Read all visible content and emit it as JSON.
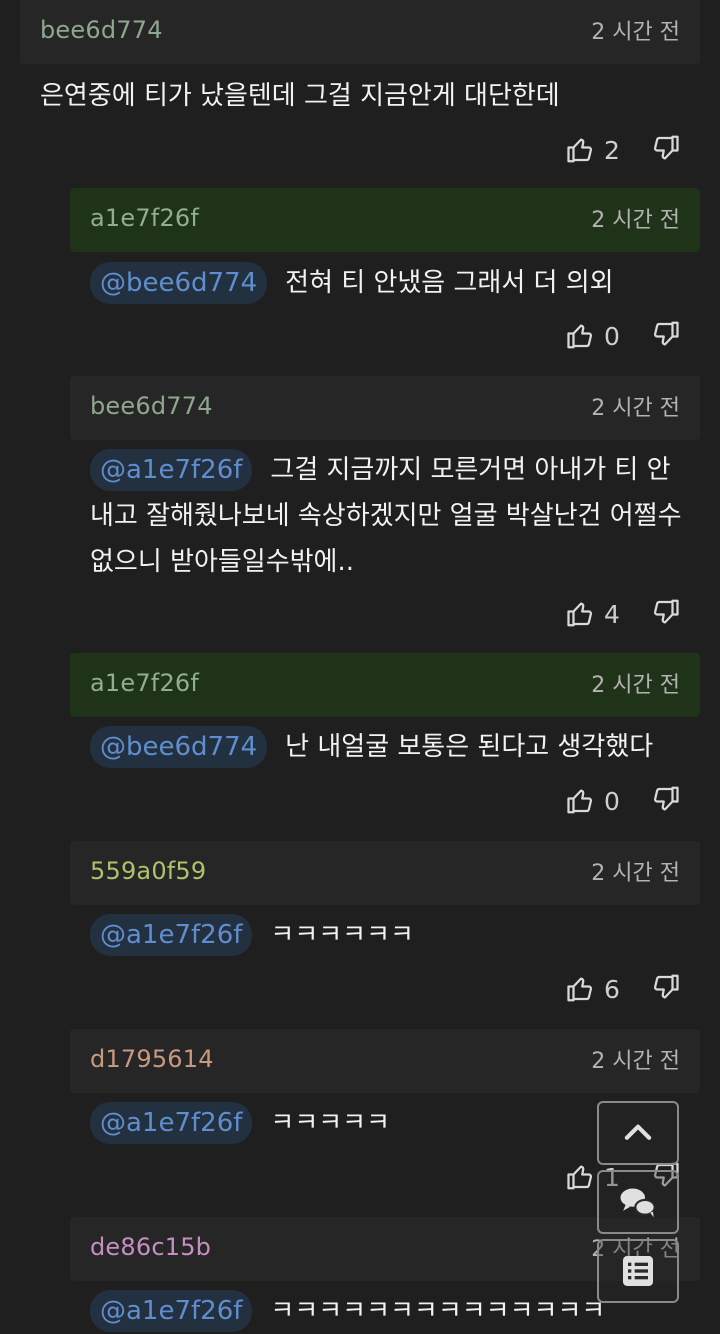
{
  "comments": [
    {
      "user": "bee6d774",
      "user_color": "#8fa68f",
      "time": "2 시간 전",
      "mention": "",
      "text": "은연중에 티가 났을텐데 그걸 지금안게 대단한데",
      "up": "2"
    },
    {
      "user": "a1e7f26f",
      "user_color": "#8fb08a",
      "time": "2 시간 전",
      "mention": "@bee6d774",
      "text": "전혀 티 안냈음 그래서 더 의외",
      "up": "0"
    },
    {
      "user": "bee6d774",
      "user_color": "#8fa68f",
      "time": "2 시간 전",
      "mention": "@a1e7f26f",
      "text_line1": "그걸 지금까지 모른거면 아내가 티 안",
      "text_line2": "내고 잘해줬나보네 속상하겠지만 얼굴 박살난건 어쩔수",
      "text_line3": "없으니 받아들일수밖에..",
      "up": "4"
    },
    {
      "user": "a1e7f26f",
      "user_color": "#8fb08a",
      "time": "2 시간 전",
      "mention": "@bee6d774",
      "text": "난 내얼굴 보통은 된다고 생각했다",
      "up": "0"
    },
    {
      "user": "559a0f59",
      "user_color": "#a9c46c",
      "time": "2 시간 전",
      "mention": "@a1e7f26f",
      "text": "ㅋㅋㅋㅋㅋㅋ",
      "up": "6"
    },
    {
      "user": "d1795614",
      "user_color": "#c79a7e",
      "time": "2 시간 전",
      "mention": "@a1e7f26f",
      "text": "ㅋㅋㅋㅋㅋ",
      "up": "1"
    },
    {
      "user": "de86c15b",
      "user_color": "#c58fc2",
      "time": "2 시간 전",
      "mention": "@a1e7f26f",
      "text": "ㅋㅋㅋㅋㅋㅋㅋㅋㅋㅋㅋㅋㅋㅋ"
    }
  ],
  "icons": {
    "up": "thumbs-up-icon",
    "down": "thumbs-down-icon",
    "top": "chevron-up-icon",
    "chat": "chat-bubbles-icon",
    "list": "list-icon"
  }
}
